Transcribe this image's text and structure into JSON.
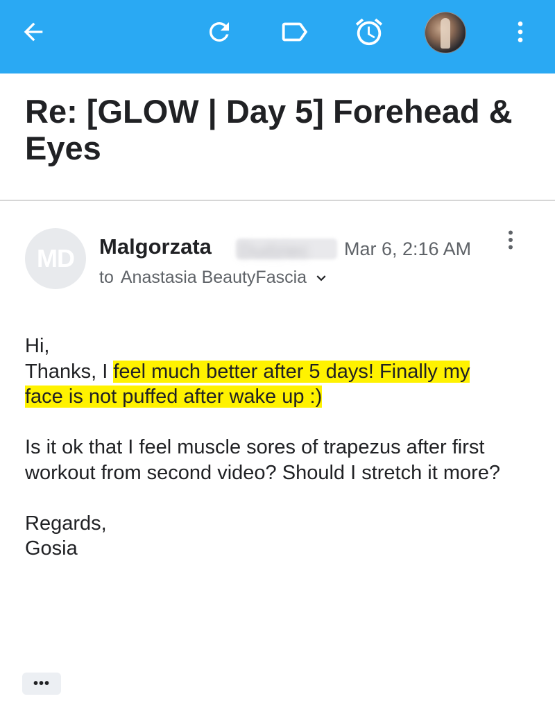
{
  "appbar": {
    "background": "#2aa9f3",
    "icons": [
      "back-arrow-icon",
      "refresh-icon",
      "label-icon",
      "snooze-alarm-icon",
      "account-avatar",
      "more-vert-icon"
    ]
  },
  "email": {
    "subject": "Re: [GLOW | Day 5] Forehead & Eyes",
    "sender": {
      "initials": "MD",
      "first_name": "Malgorzata",
      "last_name_redacted": "Dudziec",
      "date": "Mar 6, 2:16 AM",
      "to_prefix": "to",
      "recipient": "Anastasia BeautyFascia"
    },
    "body": {
      "greeting": "Hi,",
      "line1_plain": "Thanks, I ",
      "line1_highlight": "feel much better after 5 days! Finally my face is not puffed after wake up :)",
      "paragraph2": "Is it ok that I feel muscle sores of trapezus after first workout from second video? Should I stretch it more?",
      "signoff": "Regards,",
      "signature": "Gosia"
    },
    "highlight_color": "#fff200",
    "collapsed_quote_label": "•••"
  }
}
